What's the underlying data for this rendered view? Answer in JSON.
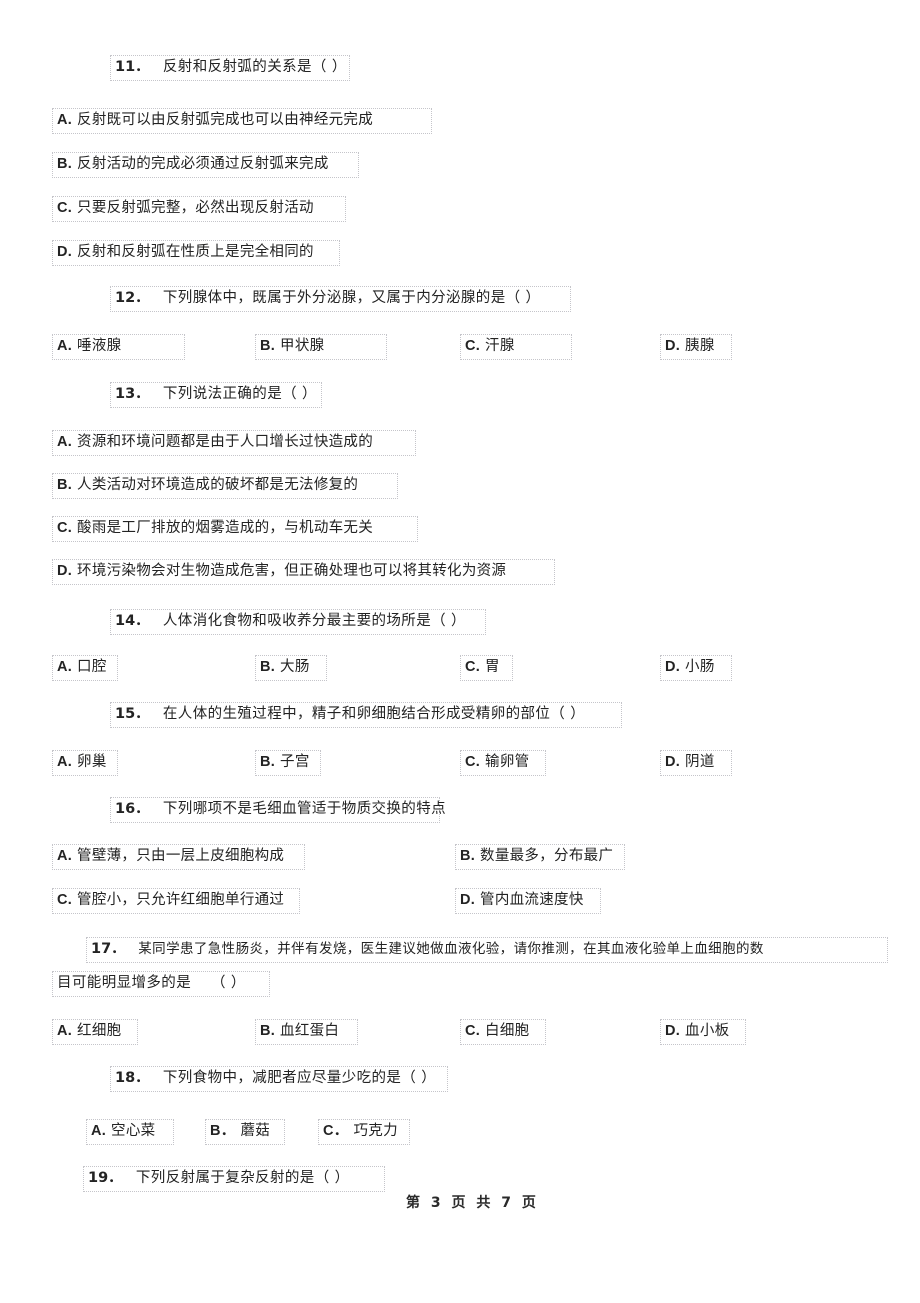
{
  "document": {
    "type": "exam-paper",
    "subject_language": "zh-CN",
    "footer": {
      "prefix": "第",
      "page_number": "3",
      "middle": "页  共",
      "total_pages": "7",
      "suffix": "页",
      "full_text": "第 3 页 共 7 页"
    }
  },
  "questions": [
    {
      "number": "11．",
      "stem": "反射和反射弧的关系是（            ）",
      "layout": "stacked",
      "options": [
        {
          "letter": "A.",
          "text": "反射既可以由反射弧完成也可以由神经元完成"
        },
        {
          "letter": "B.",
          "text": "反射活动的完成必须通过反射弧来完成"
        },
        {
          "letter": "C.",
          "text": "只要反射弧完整，必然出现反射活动"
        },
        {
          "letter": "D.",
          "text": "反射和反射弧在性质上是完全相同的"
        }
      ]
    },
    {
      "number": "12．",
      "stem": "下列腺体中，既属于外分泌腺，又属于内分泌腺的是（             ）",
      "layout": "four-column",
      "options": [
        {
          "letter": "A.",
          "text": "唾液腺"
        },
        {
          "letter": "B.",
          "text": "甲状腺"
        },
        {
          "letter": "C.",
          "text": "汗腺"
        },
        {
          "letter": "D.",
          "text": "胰腺"
        }
      ]
    },
    {
      "number": "13．",
      "stem": "下列说法正确的是（        ）",
      "layout": "stacked",
      "options": [
        {
          "letter": "A.",
          "text": "资源和环境问题都是由于人口增长过快造成的"
        },
        {
          "letter": "B.",
          "text": "人类活动对环境造成的破坏都是无法修复的"
        },
        {
          "letter": "C.",
          "text": "酸雨是工厂排放的烟雾造成的，与机动车无关"
        },
        {
          "letter": "D.",
          "text": "环境污染物会对生物造成危害，但正确处理也可以将其转化为资源"
        }
      ]
    },
    {
      "number": "14．",
      "stem": "人体消化食物和吸收养分最主要的场所是（          ）",
      "layout": "four-column",
      "options": [
        {
          "letter": "A.",
          "text": "口腔"
        },
        {
          "letter": "B.",
          "text": "大肠"
        },
        {
          "letter": "C.",
          "text": "胃"
        },
        {
          "letter": "D.",
          "text": "小肠"
        }
      ]
    },
    {
      "number": "15．",
      "stem": "在人体的生殖过程中，精子和卵细胞结合形成受精卵的部位（           ）",
      "layout": "four-column",
      "options": [
        {
          "letter": "A.",
          "text": "卵巢"
        },
        {
          "letter": "B.",
          "text": "子宫"
        },
        {
          "letter": "C.",
          "text": "输卵管"
        },
        {
          "letter": "D.",
          "text": "阴道"
        }
      ]
    },
    {
      "number": "16．",
      "stem": "下列哪项不是毛细血管适于物质交换的特点",
      "layout": "two-column",
      "options": [
        {
          "letter": "A.",
          "text": "管壁薄，只由一层上皮细胞构成"
        },
        {
          "letter": "B.",
          "text": "数量最多，分布最广"
        },
        {
          "letter": "C.",
          "text": "管腔小，只允许红细胞单行通过"
        },
        {
          "letter": "D.",
          "text": "管内血流速度快"
        }
      ]
    },
    {
      "number": "17．",
      "stem_line1": "某同学患了急性肠炎，并伴有发烧，医生建议她做血液化验，请你推测，在其血液化验单上血细胞的数",
      "stem_line2": "目可能明显增多的是　 （    ）",
      "layout": "four-column",
      "options": [
        {
          "letter": "A.",
          "text": "红细胞"
        },
        {
          "letter": "B.",
          "text": "血红蛋白"
        },
        {
          "letter": "C.",
          "text": "白细胞"
        },
        {
          "letter": "D.",
          "text": "血小板"
        }
      ]
    },
    {
      "number": "18．",
      "stem": "下列食物中，减肥者应尽量少吃的是（        ）",
      "layout": "three-column-indented",
      "options": [
        {
          "letter": "A.",
          "text": "空心菜"
        },
        {
          "letter": "B．",
          "text": "蘑菇"
        },
        {
          "letter": "C．",
          "text": "巧克力"
        }
      ]
    },
    {
      "number": "19．",
      "stem": "下列反射属于复杂反射的是（        ）",
      "layout": "stem-only",
      "options": []
    }
  ]
}
